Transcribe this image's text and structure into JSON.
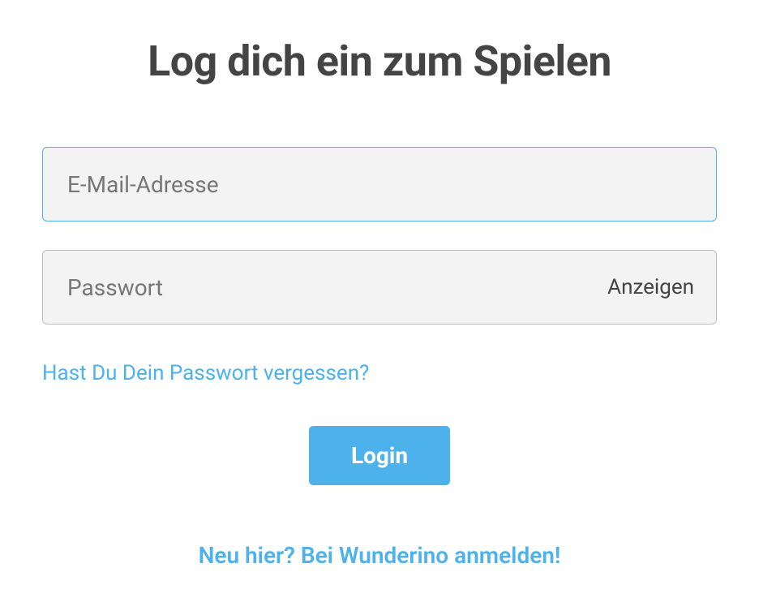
{
  "title": "Log dich ein zum Spielen",
  "form": {
    "email_placeholder": "E-Mail-Adresse",
    "email_value": "",
    "password_placeholder": "Passwort",
    "password_value": "",
    "show_password_label": "Anzeigen"
  },
  "links": {
    "forgot_password": "Hast Du Dein Passwort vergessen?",
    "signup": "Neu hier? Bei Wunderino anmelden!"
  },
  "buttons": {
    "login": "Login"
  }
}
